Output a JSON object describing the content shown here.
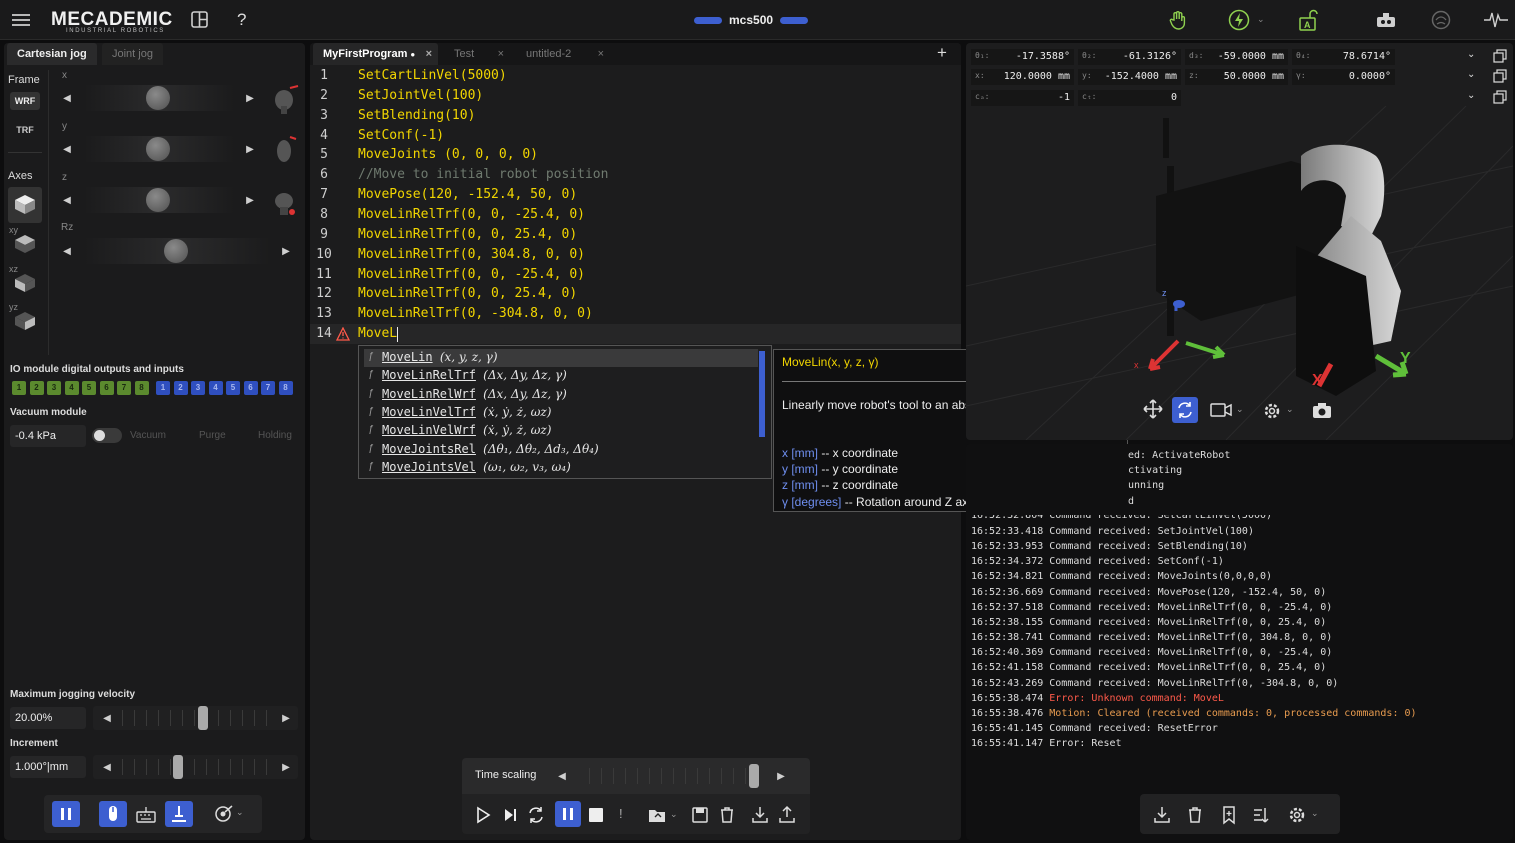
{
  "app": {
    "logo": "MECADEMIC",
    "logo_sub": "INDUSTRIAL ROBOTICS",
    "robot_name": "mcs500"
  },
  "left": {
    "tabs": [
      "Cartesian jog",
      "Joint jog"
    ],
    "frame_label": "Frame",
    "frame_wrf": "WRF",
    "frame_trf": "TRF",
    "axes_label": "Axes",
    "axes_sub": [
      "xy",
      "xz",
      "yz"
    ],
    "jog_axes": [
      "x",
      "y",
      "z",
      "Rz"
    ],
    "io_title": "IO module digital outputs and inputs",
    "io_outputs": [
      "1",
      "2",
      "3",
      "4",
      "5",
      "6",
      "7",
      "8"
    ],
    "io_inputs": [
      "1",
      "2",
      "3",
      "4",
      "5",
      "6",
      "7",
      "8"
    ],
    "vacuum_title": "Vacuum module",
    "vacuum_value": "-0.4 kPa",
    "vacuum_opts": [
      "Vacuum",
      "Purge",
      "Holding"
    ],
    "max_vel_label": "Maximum jogging velocity",
    "max_vel_value": "20.00%",
    "max_vel_fraction": 0.55,
    "increment_label": "Increment",
    "increment_value": "1.000°|mm",
    "increment_fraction": 0.38
  },
  "editor": {
    "tabs": [
      {
        "label": "MyFirstProgram",
        "modified": true,
        "active": true
      },
      {
        "label": "Test",
        "active": false
      },
      {
        "label": "untitled-2",
        "active": false
      }
    ],
    "lines": [
      {
        "n": "1",
        "text": "SetCartLinVel(5000)"
      },
      {
        "n": "2",
        "text": "SetJointVel(100)"
      },
      {
        "n": "3",
        "text": "SetBlending(10)"
      },
      {
        "n": "4",
        "text": "SetConf(-1)"
      },
      {
        "n": "5",
        "text": "MoveJoints (0, 0, 0, 0)"
      },
      {
        "n": "6",
        "text": "//Move to initial robot position",
        "comment": true
      },
      {
        "n": "7",
        "text": "MovePose(120, -152.4, 50, 0)"
      },
      {
        "n": "8",
        "text": "MoveLinRelTrf(0, 0, -25.4, 0)"
      },
      {
        "n": "9",
        "text": "MoveLinRelTrf(0, 0, 25.4, 0)"
      },
      {
        "n": "10",
        "text": "MoveLinRelTrf(0, 304.8, 0, 0)"
      },
      {
        "n": "11",
        "text": "MoveLinRelTrf(0, 0, -25.4, 0)"
      },
      {
        "n": "12",
        "text": "MoveLinRelTrf(0, 0, 25.4, 0)"
      },
      {
        "n": "13",
        "text": "MoveLinRelTrf(0, -304.8, 0, 0)"
      },
      {
        "n": "14",
        "text": "MoveL",
        "error": true
      }
    ],
    "autocomplete": [
      {
        "name": "MoveLin",
        "sig": "(x, y, z, γ)",
        "selected": true
      },
      {
        "name": "MoveLinRelTrf",
        "sig": "(Δx, Δy, Δz, γ)"
      },
      {
        "name": "MoveLinRelWrf",
        "sig": "(Δx, Δy, Δz, γ)"
      },
      {
        "name": "MoveLinVelTrf",
        "sig": "(ẋ, ẏ, ż, ωz)"
      },
      {
        "name": "MoveLinVelWrf",
        "sig": "(ẋ, ẏ, ż, ωz)"
      },
      {
        "name": "MoveJointsRel",
        "sig": "(Δθ₁, Δθ₂, Δd₃, Δθ₄)"
      },
      {
        "name": "MoveJointsVel",
        "sig": "(ω₁, ω₂, v₃, ω₄)"
      }
    ],
    "doc": {
      "sig_name": "MoveLin",
      "sig_params": "(x, y, z, γ)",
      "description": "Linearly move robot's tool to an absolute Cartesian position.",
      "params": [
        {
          "p": "x",
          "u": "[mm]",
          "d": "-- x coordinate"
        },
        {
          "p": "y",
          "u": "[mm]",
          "d": "-- y coordinate"
        },
        {
          "p": "z",
          "u": "[mm]",
          "d": "-- z coordinate"
        },
        {
          "p": "γ",
          "u": "[degrees]",
          "d": "-- Rotation around Z axis"
        }
      ]
    },
    "time_scaling_label": "Time scaling",
    "time_scaling_fraction": 0.95
  },
  "right": {
    "row1": [
      {
        "k": "θ₁:",
        "v": "-17.3588°"
      },
      {
        "k": "θ₂:",
        "v": "-61.3126°"
      },
      {
        "k": "d₃:",
        "v": "-59.0000 mm"
      },
      {
        "k": "θ₄:",
        "v": "78.6714°"
      }
    ],
    "row2": [
      {
        "k": "x:",
        "v": "120.0000 mm"
      },
      {
        "k": "y:",
        "v": "-152.4000 mm"
      },
      {
        "k": "z:",
        "v": "50.0000 mm"
      },
      {
        "k": "γ:",
        "v": "0.0000°"
      }
    ],
    "row3": [
      {
        "k": "cₐ:",
        "v": "-1"
      },
      {
        "k": "cₜ:",
        "v": "0"
      }
    ],
    "axis_labels": {
      "x": "x",
      "y": "Y",
      "z": "z",
      "red": "X"
    },
    "log_partial": [
      "ed: ActivateRobot",
      "ctivating",
      "unning",
      "d"
    ],
    "log_cut": "16:52:32.804 Command received: SetCartLinVel(5000)",
    "log": [
      {
        "t": "16:52:33.418 Command received: SetJointVel(100)"
      },
      {
        "t": "16:52:33.953 Command received: SetBlending(10)"
      },
      {
        "t": "16:52:34.372 Command received: SetConf(-1)"
      },
      {
        "t": "16:52:34.821 Command received: MoveJoints(0,0,0,0)"
      },
      {
        "t": "16:52:36.669 Command received: MovePose(120, -152.4, 50, 0)"
      },
      {
        "t": "16:52:37.518 Command received: MoveLinRelTrf(0, 0, -25.4, 0)"
      },
      {
        "t": "16:52:38.155 Command received: MoveLinRelTrf(0, 0, 25.4, 0)"
      },
      {
        "t": "16:52:38.741 Command received: MoveLinRelTrf(0, 304.8, 0, 0)"
      },
      {
        "t": "16:52:40.369 Command received: MoveLinRelTrf(0, 0, -25.4, 0)"
      },
      {
        "t": "16:52:41.158 Command received: MoveLinRelTrf(0, 0, 25.4, 0)"
      },
      {
        "t": "16:52:43.269 Command received: MoveLinRelTrf(0, -304.8, 0, 0)"
      },
      {
        "t": "16:55:38.474 ",
        "err": "Error: Unknown command: MoveL"
      },
      {
        "t": "16:55:38.476 ",
        "warn": "Motion: Cleared (received commands: 0, processed commands: 0)"
      },
      {
        "t": "16:55:41.145 Command received: ResetError"
      },
      {
        "t": "16:55:41.147 Error: Reset"
      }
    ]
  },
  "colors": {
    "accent": "#3d5fd0",
    "code": "#f2d600",
    "error": "#ff5a4a",
    "warn": "#e79b4f",
    "io_out": "#5b8a2e",
    "io_in": "#2f4fbf"
  },
  "icons": [
    "menu-icon",
    "layout-icon",
    "help-icon",
    "hand-icon",
    "power-icon",
    "auto-mode-icon",
    "robot-icon",
    "brain-icon",
    "waveform-icon"
  ]
}
